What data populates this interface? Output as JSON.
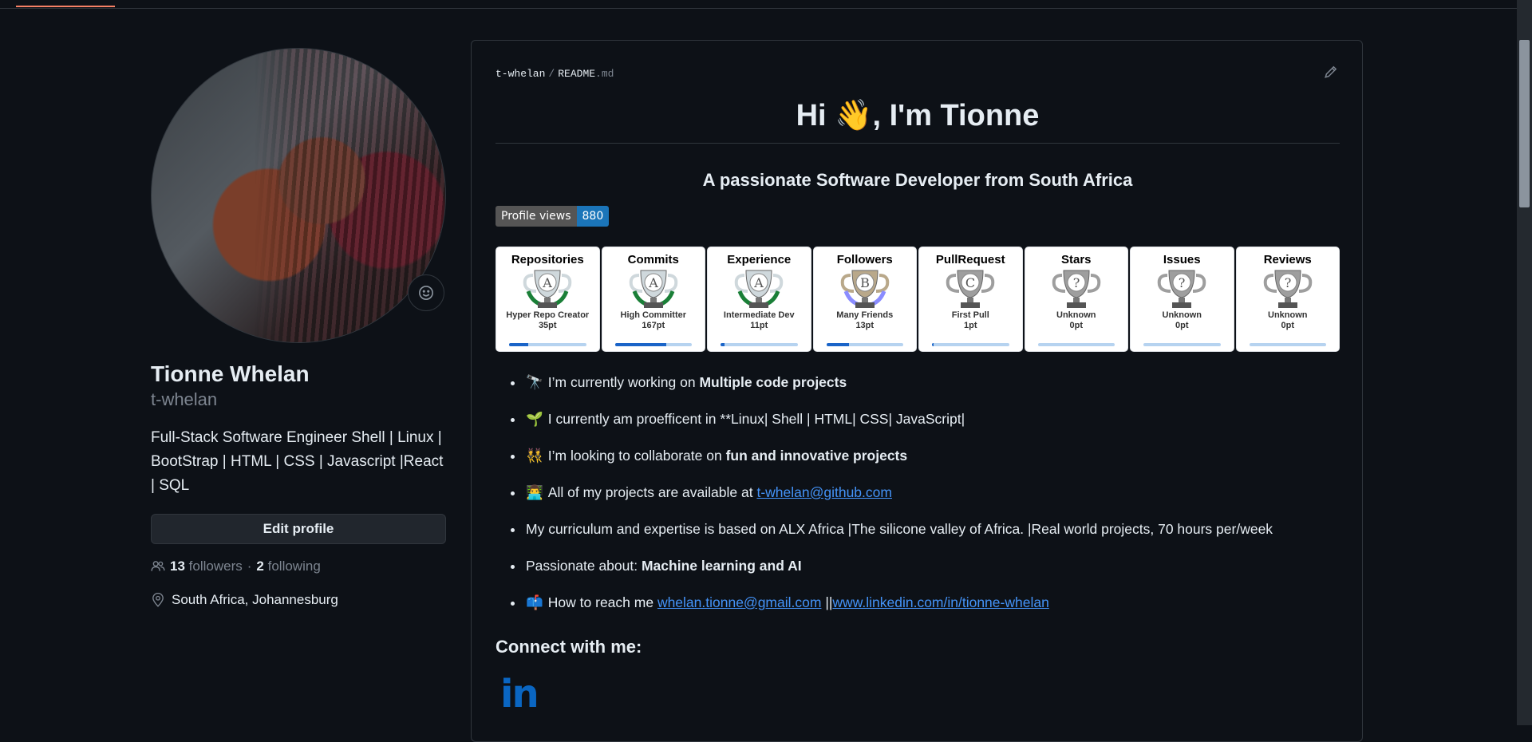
{
  "profile": {
    "full_name": "Tionne Whelan",
    "login": "t-whelan",
    "bio": "Full-Stack Software Engineer Shell | Linux | BootStrap | HTML | CSS | Javascript |React | SQL",
    "edit_label": "Edit profile",
    "followers_count": "13",
    "followers_label": "followers",
    "following_count": "2",
    "following_label": "following",
    "location": "South Africa, Johannesburg",
    "status_icon": "smiley-icon"
  },
  "readme": {
    "owner": "t-whelan",
    "file": "README",
    "ext": ".md",
    "heading": "Hi 👋, I'm Tionne",
    "subtitle": "A passionate Software Developer from South Africa",
    "views_label": "Profile views",
    "views_count": "880",
    "trophies": [
      {
        "title": "Repositories",
        "rank": "Hyper Repo Creator",
        "points": "35pt",
        "letter": "A",
        "progress": 0.25,
        "color": "#cfd8dc",
        "leaf": "#1a7f37"
      },
      {
        "title": "Commits",
        "rank": "High Committer",
        "points": "167pt",
        "letter": "A",
        "progress": 0.67,
        "color": "#cfd8dc",
        "leaf": "#1a7f37"
      },
      {
        "title": "Experience",
        "rank": "Intermediate Dev",
        "points": "11pt",
        "letter": "A",
        "progress": 0.05,
        "color": "#cfd8dc",
        "leaf": "#1a7f37"
      },
      {
        "title": "Followers",
        "rank": "Many Friends",
        "points": "13pt",
        "letter": "B",
        "progress": 0.3,
        "color": "#b9a88a",
        "leaf": "#8a8cff"
      },
      {
        "title": "PullRequest",
        "rank": "First Pull",
        "points": "1pt",
        "letter": "C",
        "progress": 0.02,
        "color": "#9e9e9e",
        "leaf": "#666666"
      },
      {
        "title": "Stars",
        "rank": "Unknown",
        "points": "0pt",
        "letter": "?",
        "progress": 0,
        "color": "#9e9e9e",
        "leaf": "#666666"
      },
      {
        "title": "Issues",
        "rank": "Unknown",
        "points": "0pt",
        "letter": "?",
        "progress": 0,
        "color": "#9e9e9e",
        "leaf": "#666666"
      },
      {
        "title": "Reviews",
        "rank": "Unknown",
        "points": "0pt",
        "letter": "?",
        "progress": 0,
        "color": "#9e9e9e",
        "leaf": "#666666"
      }
    ],
    "items": {
      "i1": {
        "emoji": "🔭",
        "text": "I’m currently working on ",
        "bold": "Multiple code projects"
      },
      "i2": {
        "emoji": "🌱",
        "text": "I currently am proefficent in **Linux| Shell | HTML| CSS| JavaScript|"
      },
      "i3": {
        "emoji": "👯",
        "text": "I’m looking to collaborate on ",
        "bold": "fun and innovative projects"
      },
      "i4": {
        "emoji": "👨‍💻",
        "text": "All of my projects are available at ",
        "link": "t-whelan@github.com"
      },
      "i5": {
        "text": "My curriculum and expertise is based on ALX Africa |The silicone valley of Africa. |Real world projects, 70 hours per/week"
      },
      "i6": {
        "text": "Passionate about: ",
        "bold": "Machine learning and AI"
      },
      "i7": {
        "emoji": "📫",
        "text": "How to reach me ",
        "link1": "whelan.tionne@gmail.com",
        "sep": " ||",
        "link2": "www.linkedin.com/in/tionne-whelan"
      }
    },
    "connect": "Connect with me:",
    "linkedin_icon": "linkedin-icon",
    "linkedin_glyph": "in"
  }
}
